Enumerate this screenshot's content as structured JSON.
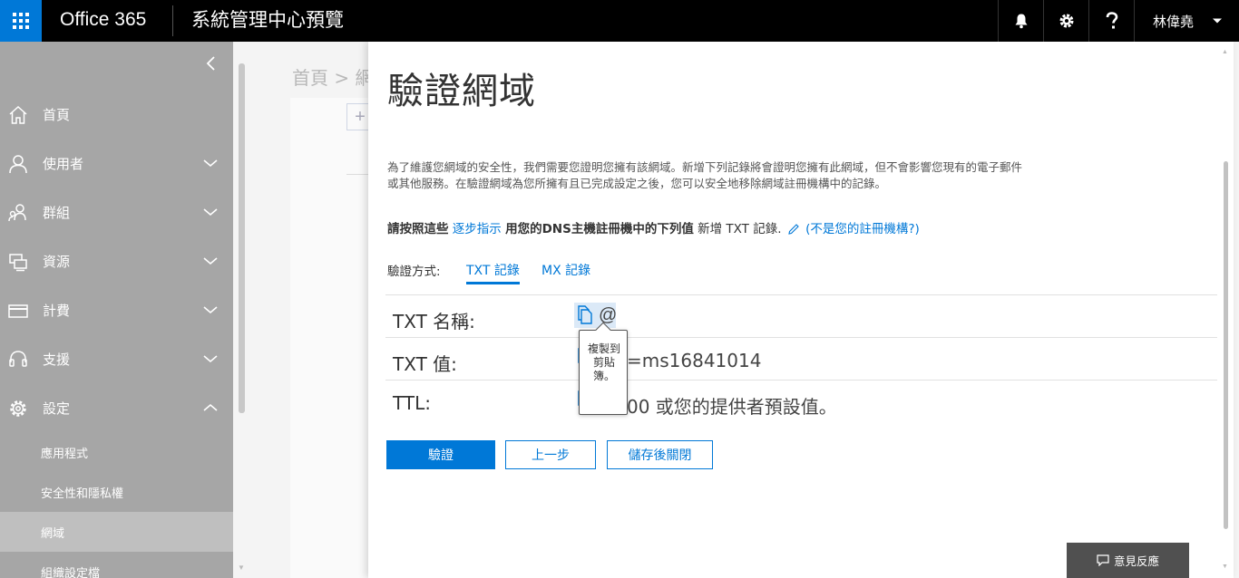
{
  "topbar": {
    "brand": "Office 365",
    "app_title": "系統管理中心預覽",
    "user_name": "林偉堯",
    "icons": [
      "app-launcher-icon",
      "bell-icon",
      "gear-icon",
      "help-icon",
      "chevron-down-icon"
    ]
  },
  "leftnav": {
    "items": [
      {
        "label": "首頁",
        "icon": "home-icon"
      },
      {
        "label": "使用者",
        "icon": "user-icon"
      },
      {
        "label": "群組",
        "icon": "group-icon"
      },
      {
        "label": "資源",
        "icon": "resources-icon"
      },
      {
        "label": "計費",
        "icon": "billing-icon"
      },
      {
        "label": "支援",
        "icon": "headset-icon"
      },
      {
        "label": "設定",
        "icon": "gear-icon"
      }
    ],
    "subitems": [
      {
        "label": "應用程式"
      },
      {
        "label": "安全性和隱私權"
      },
      {
        "label": "網域",
        "active": true
      },
      {
        "label": "組織設定檔"
      }
    ]
  },
  "background": {
    "breadcrumb": "首頁 > 網域",
    "add_symbol": "+"
  },
  "panel": {
    "title": "驗證網域",
    "description": "為了維護您網域的安全性，我們需要您證明您擁有該網域。新增下列記錄將會證明您擁有此網域，但不會影響您現有的電子郵件或其他服務。在驗證網域為您所擁有且已完成設定之後，您可以安全地移除網域註冊機構中的記錄。",
    "instruction": {
      "part1": "請按照這些",
      "link": "逐步指示",
      "part2": "用您的DNS主機註冊機中的下列值",
      "part3": "新增",
      "part4": "TXT 記錄.",
      "link2": "(不是您的註冊機構?)"
    },
    "method_label": "驗證方式:",
    "tabs": [
      {
        "label": "TXT 記錄",
        "selected": true
      },
      {
        "label": "MX 記錄",
        "selected": false
      }
    ],
    "records": [
      {
        "label": "TXT 名稱:",
        "value": "@"
      },
      {
        "label": "TXT 值:",
        "value": "=ms16841014"
      },
      {
        "label": "TTL:",
        "value": "00 或您的提供者預設值。"
      }
    ],
    "tooltip": "複製到剪貼簿。",
    "buttons": {
      "verify": "驗證",
      "back": "上一步",
      "save_close": "儲存後關閉"
    }
  },
  "feedback": {
    "label": "意見反應"
  }
}
